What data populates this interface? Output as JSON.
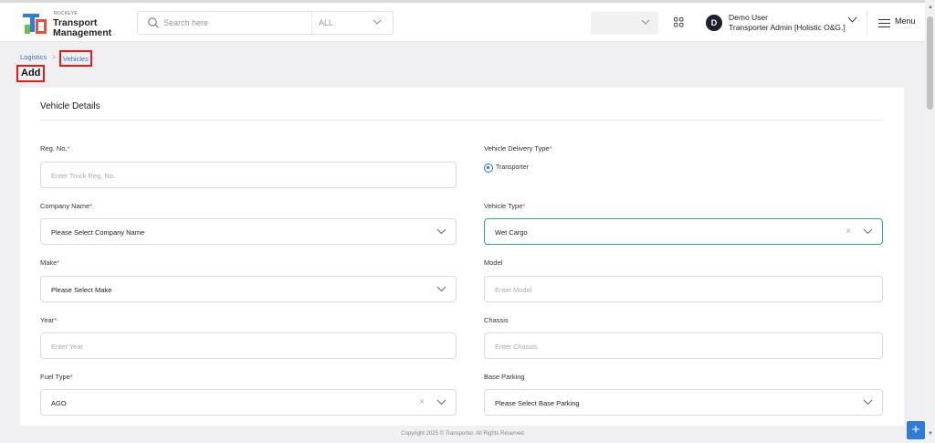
{
  "header": {
    "logo_small": "ROCKEYE",
    "logo_line1": "Transport",
    "logo_line2": "Management",
    "search_placeholder": "Search here",
    "search_scope": "ALL",
    "user_initial": "D",
    "user_name": "Demo User",
    "user_role": "Transporter Admin [Holistic O&G.]",
    "menu_label": "Menu"
  },
  "breadcrumb": {
    "root": "Logistics",
    "separator": ">",
    "current": "Vehicles"
  },
  "page_title": "Add",
  "section_title": "Vehicle Details",
  "fields": {
    "reg_no": {
      "label": "Reg. No.",
      "placeholder": "Enter Truck Reg. No."
    },
    "delivery_type": {
      "label": "Vehicle Delivery Type",
      "option": "Transporter"
    },
    "company_name": {
      "label": "Company Name",
      "value": "Please Select Company Name"
    },
    "vehicle_type": {
      "label": "Vehicle Type",
      "value": "Wet Cargo"
    },
    "make": {
      "label": "Make",
      "value": "Please Select Make"
    },
    "model": {
      "label": "Model",
      "placeholder": "Enter Model"
    },
    "year": {
      "label": "Year",
      "placeholder": "Enter Year"
    },
    "chassis": {
      "label": "Chassis",
      "placeholder": "Enter Chassis"
    },
    "fuel_type": {
      "label": "Fuel Type",
      "value": "AGO"
    },
    "base_parking": {
      "label": "Base Parking",
      "value": "Please Select Base Parking"
    }
  },
  "required_mark": "*",
  "clear_glyph": "×",
  "fab_label": "+",
  "footer": "Copyright 2025 © Transporter. All Rights Reserved",
  "colors": {
    "accent": "#2f7bd7",
    "link": "#3b6fc8",
    "required": "#e53935",
    "highlight": "#e41a1a",
    "active_border": "#3aa58a"
  }
}
